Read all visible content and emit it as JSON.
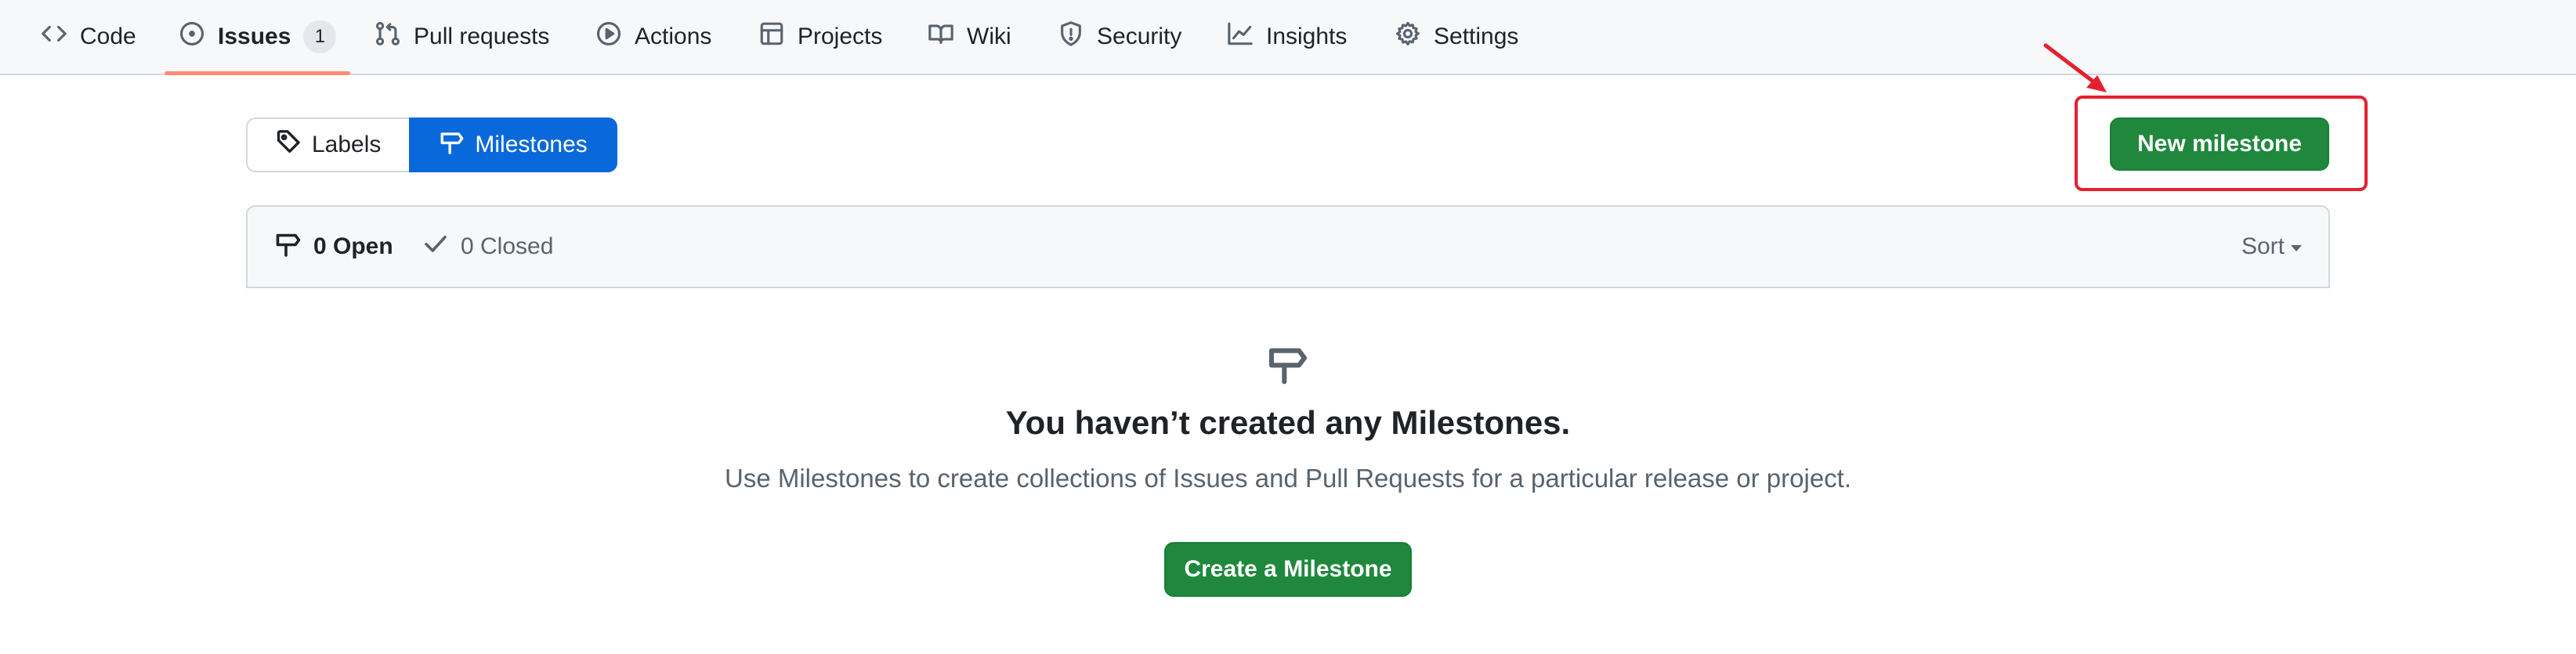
{
  "repo_nav": {
    "items": [
      {
        "label": "Code",
        "icon": "code-icon"
      },
      {
        "label": "Issues",
        "icon": "issue-opened-icon",
        "counter": "1",
        "active": true
      },
      {
        "label": "Pull requests",
        "icon": "git-pull-request-icon"
      },
      {
        "label": "Actions",
        "icon": "play-icon"
      },
      {
        "label": "Projects",
        "icon": "table-icon"
      },
      {
        "label": "Wiki",
        "icon": "book-icon"
      },
      {
        "label": "Security",
        "icon": "shield-icon"
      },
      {
        "label": "Insights",
        "icon": "graph-icon"
      },
      {
        "label": "Settings",
        "icon": "gear-icon"
      }
    ],
    "active_underline_color": "#fd8c73"
  },
  "subnav": {
    "labels": "Labels",
    "milestones": "Milestones",
    "selected": "Milestones",
    "selected_color": "#0969da"
  },
  "actions": {
    "new_milestone": "New milestone",
    "highlight_color": "#e5202e"
  },
  "milestones_header": {
    "open_label": "0 Open",
    "closed_label": "0 Closed",
    "sort_label": "Sort"
  },
  "blankslate": {
    "icon": "milestone-icon",
    "title": "You haven’t created any Milestones.",
    "description": "Use Milestones to create collections of Issues and Pull Requests for a particular release or project.",
    "button": "Create a Milestone"
  },
  "colors": {
    "primary_button": "#1f883d",
    "muted_text": "#59636e",
    "border": "#d0d7de"
  }
}
